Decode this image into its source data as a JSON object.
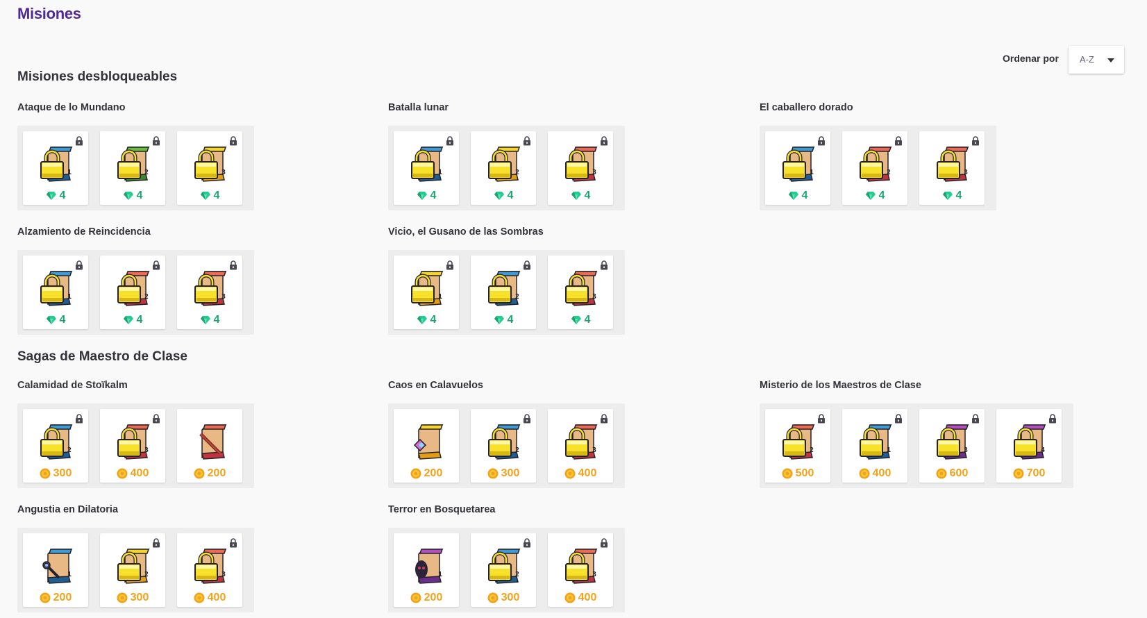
{
  "page_title": "Misiones",
  "sort": {
    "label": "Ordenar por",
    "value": "A-Z"
  },
  "colors": {
    "title": "#4f2a93",
    "gem": "#1ca372",
    "gold": "#f0a31a",
    "lock_yellow": "#f7e12a"
  },
  "sections": [
    {
      "title": "Misiones desbloqueables",
      "groups": [
        {
          "title": "Ataque de lo Mundano",
          "items": [
            {
              "icon": "scroll-blue",
              "num": "1",
              "locked": true,
              "currency": "gem",
              "price": "4"
            },
            {
              "icon": "scroll-green",
              "num": "2",
              "locked": true,
              "currency": "gem",
              "price": "4"
            },
            {
              "icon": "scroll-yellow",
              "num": "3",
              "locked": true,
              "currency": "gem",
              "price": "4"
            }
          ]
        },
        {
          "title": "Batalla lunar",
          "items": [
            {
              "icon": "scroll-blue",
              "num": "1",
              "locked": true,
              "currency": "gem",
              "price": "4"
            },
            {
              "icon": "scroll-yellow",
              "num": "2",
              "locked": true,
              "currency": "gem",
              "price": "4"
            },
            {
              "icon": "scroll-red",
              "num": "3",
              "locked": true,
              "currency": "gem",
              "price": "4"
            }
          ]
        },
        {
          "title": "El caballero dorado",
          "items": [
            {
              "icon": "scroll-blue",
              "num": "1",
              "locked": true,
              "currency": "gem",
              "price": "4"
            },
            {
              "icon": "scroll-red",
              "num": "2",
              "locked": true,
              "currency": "gem",
              "price": "4"
            },
            {
              "icon": "scroll-red",
              "num": "3",
              "locked": true,
              "currency": "gem",
              "price": "4"
            }
          ]
        },
        {
          "title": "Alzamiento de Reincidencia",
          "items": [
            {
              "icon": "scroll-blue",
              "num": "1",
              "locked": true,
              "currency": "gem",
              "price": "4"
            },
            {
              "icon": "scroll-red",
              "num": "2",
              "locked": true,
              "currency": "gem",
              "price": "4"
            },
            {
              "icon": "scroll-red",
              "num": "3",
              "locked": true,
              "currency": "gem",
              "price": "4"
            }
          ]
        },
        {
          "title": "Vicio, el Gusano de las Sombras",
          "items": [
            {
              "icon": "scroll-yellow",
              "num": "1",
              "locked": true,
              "currency": "gem",
              "price": "4"
            },
            {
              "icon": "scroll-blue",
              "num": "2",
              "locked": true,
              "currency": "gem",
              "price": "4"
            },
            {
              "icon": "scroll-red",
              "num": "3",
              "locked": true,
              "currency": "gem",
              "price": "4"
            }
          ]
        }
      ]
    },
    {
      "title": "Sagas de Maestro de Clase",
      "groups": [
        {
          "title": "Calamidad de Stoïkalm",
          "items": [
            {
              "icon": "scroll-blue",
              "num": "2",
              "locked": true,
              "currency": "gold",
              "price": "300"
            },
            {
              "icon": "scroll-red",
              "num": "3",
              "locked": true,
              "currency": "gold",
              "price": "400"
            },
            {
              "icon": "scroll-red-sword",
              "num": "",
              "locked": false,
              "currency": "gold",
              "price": "200"
            }
          ]
        },
        {
          "title": "Caos en Calavuelos",
          "items": [
            {
              "icon": "scroll-yellow-crystal",
              "num": "",
              "locked": false,
              "currency": "gold",
              "price": "200"
            },
            {
              "icon": "scroll-blue",
              "num": "2",
              "locked": true,
              "currency": "gold",
              "price": "300"
            },
            {
              "icon": "scroll-red",
              "num": "3",
              "locked": true,
              "currency": "gold",
              "price": "400"
            }
          ]
        },
        {
          "title": "Misterio de los Maestros de Clase",
          "items": [
            {
              "icon": "scroll-red",
              "num": "2",
              "locked": true,
              "currency": "gold",
              "price": "500"
            },
            {
              "icon": "scroll-blue",
              "num": "1",
              "locked": true,
              "currency": "gold",
              "price": "400"
            },
            {
              "icon": "scroll-purple",
              "num": "3",
              "locked": true,
              "currency": "gold",
              "price": "600"
            },
            {
              "icon": "scroll-purple",
              "num": "4",
              "locked": true,
              "currency": "gold",
              "price": "700"
            }
          ]
        },
        {
          "title": "Angustia en Dilatoria",
          "items": [
            {
              "icon": "scroll-blue-wand",
              "num": "1",
              "locked": false,
              "currency": "gold",
              "price": "200"
            },
            {
              "icon": "scroll-yellow",
              "num": "2",
              "locked": true,
              "currency": "gold",
              "price": "300"
            },
            {
              "icon": "scroll-red",
              "num": "3",
              "locked": true,
              "currency": "gold",
              "price": "400"
            }
          ]
        },
        {
          "title": "Terror en Bosquetarea",
          "items": [
            {
              "icon": "scroll-purple-creature",
              "num": "1",
              "locked": false,
              "currency": "gold",
              "price": "200"
            },
            {
              "icon": "scroll-blue",
              "num": "2",
              "locked": true,
              "currency": "gold",
              "price": "300"
            },
            {
              "icon": "scroll-red",
              "num": "3",
              "locked": true,
              "currency": "gold",
              "price": "400"
            }
          ]
        }
      ]
    }
  ]
}
